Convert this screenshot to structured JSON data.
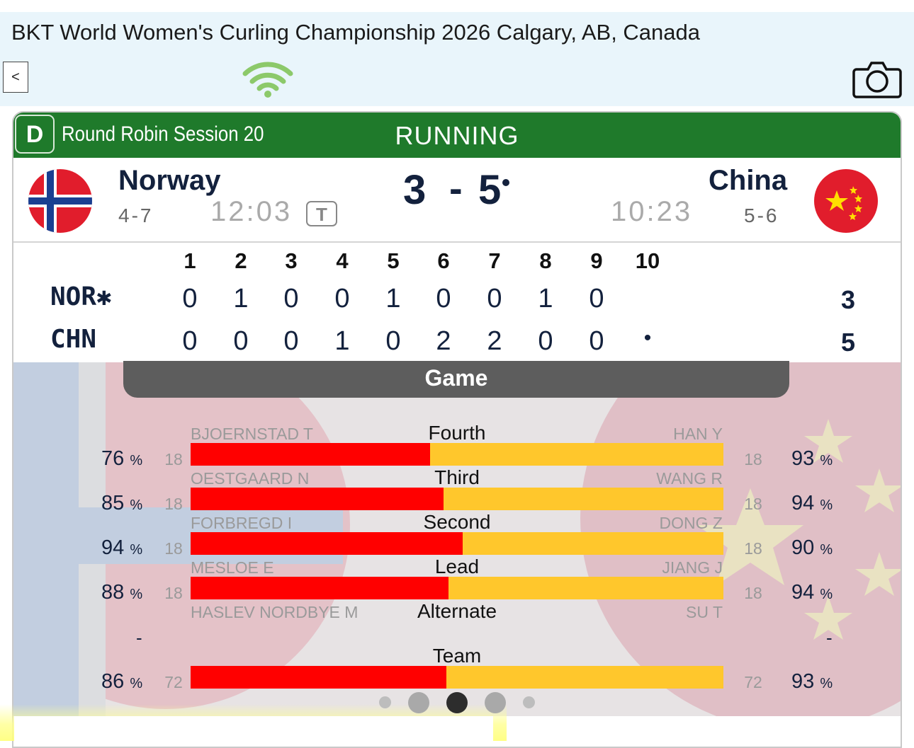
{
  "app": {
    "title": "BKT World Women's Curling Championship 2026 Calgary, AB, Canada",
    "back_label": "<",
    "wifi_icon": "wifi-icon",
    "camera_icon": "camera-icon"
  },
  "game": {
    "sheet": "D",
    "session": "Round Robin Session 20",
    "status": "RUNNING",
    "status_color": "#1f7a2b"
  },
  "home": {
    "name": "Norway",
    "abbr": "NOR✱",
    "record": "4-7",
    "time": "12:03",
    "timeout_label": "T",
    "score": "3",
    "ends": [
      "0",
      "1",
      "0",
      "0",
      "1",
      "0",
      "0",
      "1",
      "0",
      ""
    ],
    "total": "3"
  },
  "away": {
    "name": "China",
    "abbr": "CHN",
    "record": "5-6",
    "time": "10:23",
    "score": "5",
    "ends": [
      "0",
      "0",
      "0",
      "1",
      "0",
      "2",
      "2",
      "0",
      "0",
      "•"
    ],
    "total": "5"
  },
  "score_separator": "-",
  "end_numbers": [
    "1",
    "2",
    "3",
    "4",
    "5",
    "6",
    "7",
    "8",
    "9",
    "10"
  ],
  "stats": {
    "tab_label": "Game",
    "rows": [
      {
        "position": "Fourth",
        "home_player": "BJOERNSTAD T",
        "away_player": "HAN Y",
        "home_pct": "76",
        "home_shots": "18",
        "away_pct": "93",
        "away_shots": "18",
        "home_share": 0.45
      },
      {
        "position": "Third",
        "home_player": "OESTGAARD N",
        "away_player": "WANG R",
        "home_pct": "85",
        "home_shots": "18",
        "away_pct": "94",
        "away_shots": "18",
        "home_share": 0.475
      },
      {
        "position": "Second",
        "home_player": "FORBREGD I",
        "away_player": "DONG Z",
        "home_pct": "94",
        "home_shots": "18",
        "away_pct": "90",
        "away_shots": "18",
        "home_share": 0.51
      },
      {
        "position": "Lead",
        "home_player": "MESLOE E",
        "away_player": "JIANG J",
        "home_pct": "88",
        "home_shots": "18",
        "away_pct": "94",
        "away_shots": "18",
        "home_share": 0.484
      }
    ],
    "alternate": {
      "position": "Alternate",
      "home_player": "HASLEV NORDBYE M",
      "away_player": "SU T",
      "home_pct": "-",
      "away_pct": "-"
    },
    "team": {
      "position": "Team",
      "home_pct": "86",
      "home_shots": "72",
      "away_pct": "93",
      "away_shots": "72",
      "home_share": 0.48
    },
    "pct_unit": "%"
  },
  "pager": {
    "pages": 5,
    "active": 2
  },
  "colors": {
    "home_bar": "#ff0000",
    "away_bar": "#ffc72c",
    "header_green": "#1f7a2b",
    "navy": "#13213d"
  }
}
